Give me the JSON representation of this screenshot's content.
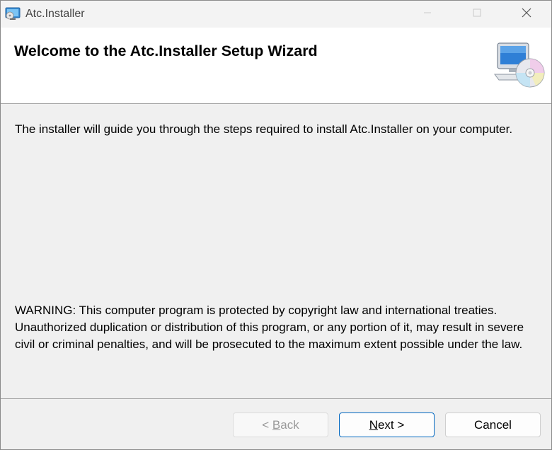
{
  "window": {
    "title": "Atc.Installer",
    "icon": "installer-app-icon",
    "controls": [
      "minimize-icon",
      "maximize-icon",
      "close-icon"
    ]
  },
  "header": {
    "title": "Welcome to the Atc.Installer Setup Wizard",
    "icon": "computer-cd-icon"
  },
  "body": {
    "intro": "The installer will guide you through the steps required to install Atc.Installer on your computer.",
    "warning": "WARNING: This computer program is protected by copyright law and international treaties. Unauthorized duplication or distribution of this program, or any portion of it, may result in severe civil or criminal penalties, and will be prosecuted to the maximum extent possible under the law."
  },
  "buttons": {
    "back": {
      "prefix": "< ",
      "access_key": "B",
      "rest": "ack",
      "enabled": false
    },
    "next": {
      "access_key": "N",
      "rest": "ext >",
      "enabled": true
    },
    "cancel": {
      "label": "Cancel",
      "enabled": true
    }
  },
  "colors": {
    "accent": "#0067c0",
    "disabled_text": "#9a9a9a"
  }
}
